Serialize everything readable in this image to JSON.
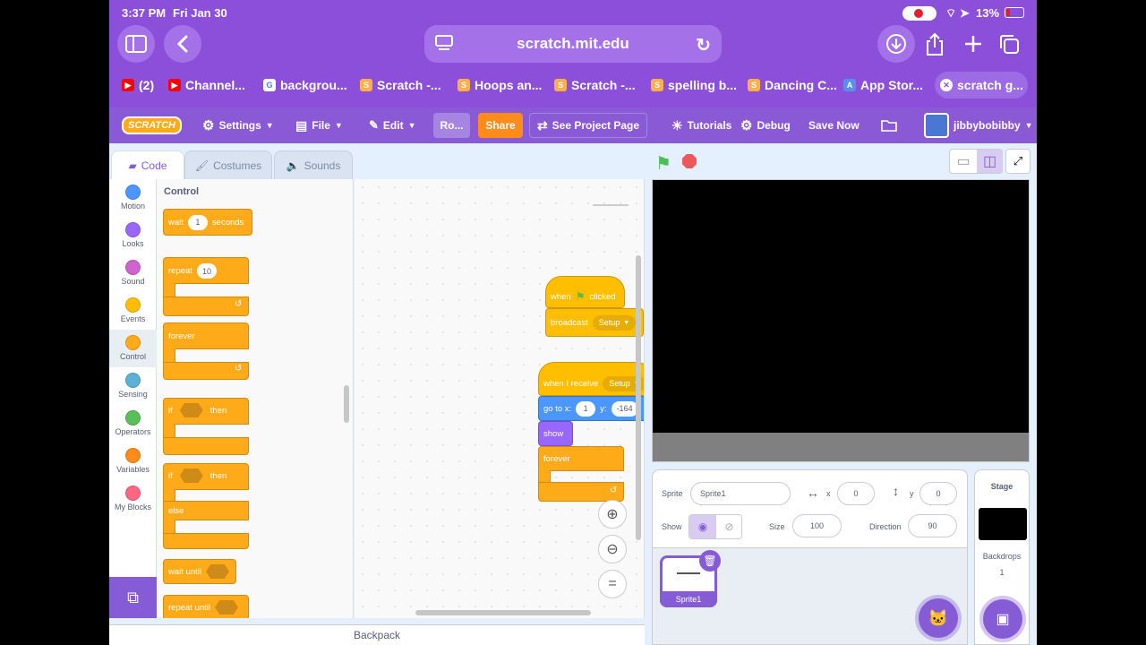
{
  "status_bar": {
    "time": "3:37 PM",
    "date": "Fri Jan 30",
    "battery": "13%"
  },
  "browser": {
    "url": "scratch.mit.edu",
    "tabs": [
      {
        "label": "(2)",
        "icon": "youtube-icon"
      },
      {
        "label": "Channel...",
        "icon": "youtube-icon"
      },
      {
        "label": "backgrou...",
        "icon": "google-icon"
      },
      {
        "label": "Scratch -...",
        "icon": "scratch-icon"
      },
      {
        "label": "Hoops an...",
        "icon": "scratch-icon"
      },
      {
        "label": "Scratch -...",
        "icon": "scratch-icon"
      },
      {
        "label": "spelling b...",
        "icon": "scratch-icon"
      },
      {
        "label": "Dancing C...",
        "icon": "scratch-icon"
      },
      {
        "label": "App Stor...",
        "icon": "appstore-icon"
      },
      {
        "label": "scratch g...",
        "icon": "close-icon"
      }
    ]
  },
  "menu": {
    "logo": "SCRATCH",
    "settings": "Settings",
    "file": "File",
    "edit": "Edit",
    "project_title": "Ro...",
    "share": "Share",
    "see_project": "See Project Page",
    "tutorials": "Tutorials",
    "debug": "Debug",
    "save_now": "Save Now",
    "username": "jibbybobibby"
  },
  "editor_tabs": {
    "code": "Code",
    "costumes": "Costumes",
    "sounds": "Sounds"
  },
  "categories": [
    {
      "label": "Motion",
      "color": "#4c97ff"
    },
    {
      "label": "Looks",
      "color": "#9966ff"
    },
    {
      "label": "Sound",
      "color": "#cf63cf"
    },
    {
      "label": "Events",
      "color": "#ffbf00"
    },
    {
      "label": "Control",
      "color": "#ffab19"
    },
    {
      "label": "Sensing",
      "color": "#5cb1d6"
    },
    {
      "label": "Operators",
      "color": "#59c059"
    },
    {
      "label": "Variables",
      "color": "#ff8c1a"
    },
    {
      "label": "My Blocks",
      "color": "#ff6680"
    }
  ],
  "palette": {
    "heading": "Control",
    "wait": {
      "label": "wait",
      "value": "1",
      "suffix": "seconds"
    },
    "repeat": {
      "label": "repeat",
      "value": "10"
    },
    "forever": "forever",
    "if_then": {
      "if": "if",
      "then": "then"
    },
    "if_else": {
      "if": "if",
      "then": "then",
      "else": "else"
    },
    "wait_until": "wait until",
    "repeat_until": "repeat until"
  },
  "scripts": {
    "s1": {
      "hat_when": "when",
      "hat_clicked": "clicked",
      "broadcast": "broadcast",
      "broadcast_msg": "Setup"
    },
    "s2": {
      "hat": "when I receive",
      "msg": "Setup",
      "goto": "go to x:",
      "x": "1",
      "y_label": "y:",
      "y": "-164",
      "show": "show",
      "forever": "forever"
    }
  },
  "backpack": "Backpack",
  "sprite_info": {
    "sprite_label": "Sprite",
    "sprite_name": "Sprite1",
    "x_label": "x",
    "x": "0",
    "y_label": "y",
    "y": "0",
    "show_label": "Show",
    "size_label": "Size",
    "size": "100",
    "direction_label": "Direction",
    "direction": "90"
  },
  "sprite_list": [
    {
      "name": "Sprite1"
    }
  ],
  "stage_panel": {
    "title": "Stage",
    "backdrops_label": "Backdrops",
    "backdrops_count": "1"
  },
  "colors": {
    "scratch_purple": "#855cd6",
    "control": "#ffab19",
    "events": "#ffbf00",
    "motion": "#4c97ff",
    "looks": "#9966ff",
    "share": "#ff8c1a"
  }
}
